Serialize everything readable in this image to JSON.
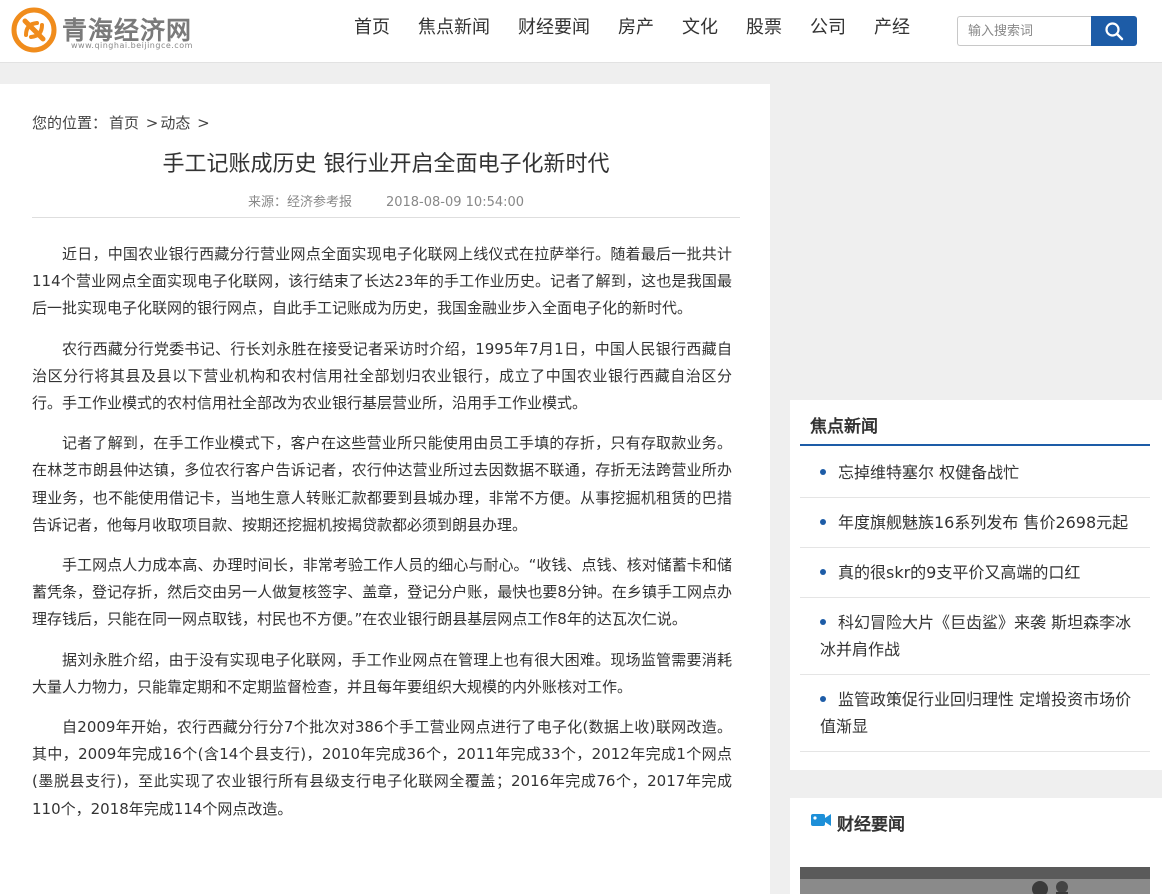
{
  "site": {
    "logo_text": "青海经济网",
    "logo_sub": "www.qinghai.beijingce.com"
  },
  "nav": {
    "items": [
      "首页",
      "焦点新闻",
      "财经要闻",
      "房产",
      "文化",
      "股票",
      "公司",
      "产经"
    ]
  },
  "search": {
    "placeholder": "输入搜索词",
    "icon": "search-icon"
  },
  "breadcrumb": {
    "label": "您的位置：",
    "home": "首页",
    "sep1": " >",
    "section": "动态",
    "sep2": " >"
  },
  "article": {
    "title": "手工记账成历史 银行业开启全面电子化新时代",
    "source": "来源：经济参考报",
    "date": "2018-08-09 10:54:00",
    "paragraphs": [
      "近日，中国农业银行西藏分行营业网点全面实现电子化联网上线仪式在拉萨举行。随着最后一批共计114个营业网点全面实现电子化联网，该行结束了长达23年的手工作业历史。记者了解到，这也是我国最后一批实现电子化联网的银行网点，自此手工记账成为历史，我国金融业步入全面电子化的新时代。",
      "农行西藏分行党委书记、行长刘永胜在接受记者采访时介绍，1995年7月1日，中国人民银行西藏自治区分行将其县及县以下营业机构和农村信用社全部划归农业银行，成立了中国农业银行西藏自治区分行。手工作业模式的农村信用社全部改为农业银行基层营业所，沿用手工作业模式。",
      "记者了解到，在手工作业模式下，客户在这些营业所只能使用由员工手填的存折，只有存取款业务。在林芝市朗县仲达镇，多位农行客户告诉记者，农行仲达营业所过去因数据不联通，存折无法跨营业所办理业务，也不能使用借记卡，当地生意人转账汇款都要到县城办理，非常不方便。从事挖掘机租赁的巴措告诉记者，他每月收取项目款、按期还挖掘机按揭贷款都必须到朗县办理。",
      "手工网点人力成本高、办理时间长，非常考验工作人员的细心与耐心。“收钱、点钱、核对储蓄卡和储蓄凭条，登记存折，然后交由另一人做复核签字、盖章，登记分户账，最快也要8分钟。在乡镇手工网点办理存钱后，只能在同一网点取钱，村民也不方便。”在农业银行朗县基层网点工作8年的达瓦次仁说。",
      "据刘永胜介绍，由于没有实现电子化联网，手工作业网点在管理上也有很大困难。现场监管需要消耗大量人力物力，只能靠定期和不定期监督检查，并且每年要组织大规模的内外账核对工作。",
      "自2009年开始，农行西藏分行分7个批次对386个手工营业网点进行了电子化(数据上收)联网改造。其中，2009年完成16个(含14个县支行)，2010年完成36个，2011年完成33个，2012年完成1个网点(墨脱县支行)，至此实现了农业银行所有县级支行电子化联网全覆盖；2016年完成76个，2017年完成110个，2018年完成114个网点改造。"
    ]
  },
  "sidebar": {
    "focus": {
      "title": "焦点新闻",
      "items": [
        "忘掉维特塞尔 权健备战忙",
        "年度旗舰魅族16系列发布 售价2698元起",
        "真的很skr的9支平价又高端的口红",
        "科幻冒险大片《巨齿鲨》来袭 斯坦森李冰冰并肩作战",
        "监管政策促行业回归理性 定增投资市场价值渐显"
      ]
    },
    "finance": {
      "title": "财经要闻",
      "icon": "video-camera-icon"
    }
  },
  "colors": {
    "accent": "#1d5ca7",
    "logo_orange": "#f08c1c",
    "background": "#efefef"
  }
}
